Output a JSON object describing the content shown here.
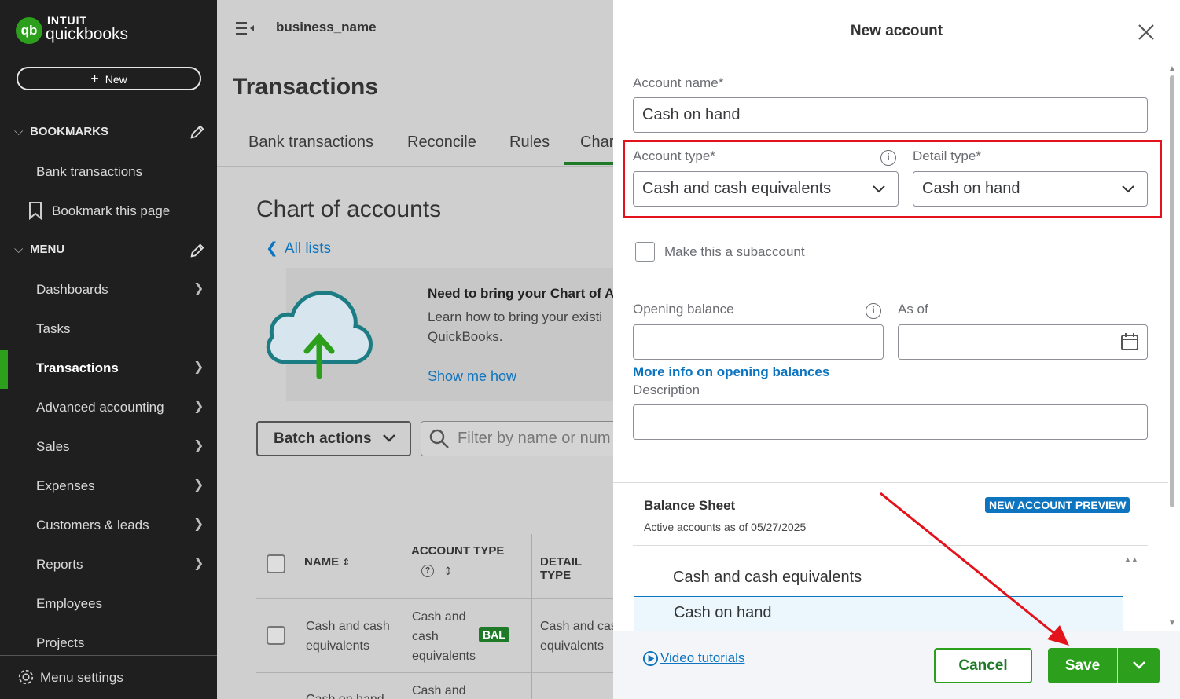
{
  "sidebar": {
    "brand_top": "INTUIT",
    "brand_bottom": "quickbooks",
    "new_label": "New",
    "bookmarks_heading": "BOOKMARKS",
    "bookmarks": [
      "Bank transactions",
      "Bookmark this page"
    ],
    "menu_heading": "MENU",
    "menu_items": [
      "Dashboards",
      "Tasks",
      "Transactions",
      "Advanced accounting",
      "Sales",
      "Expenses",
      "Customers & leads",
      "Reports",
      "Employees",
      "Projects"
    ],
    "menu_settings": "Menu settings",
    "accent_color": "#2ca01c"
  },
  "header": {
    "business_name": "business_name"
  },
  "main": {
    "page_title": "Transactions",
    "tabs": [
      "Bank transactions",
      "Reconcile",
      "Rules",
      "Char"
    ],
    "section_title": "Chart of accounts",
    "back_link": "All lists",
    "banner_title": "Need to bring your Chart of A",
    "banner_text_1": "Learn how to bring your existi",
    "banner_text_2": "QuickBooks.",
    "banner_link": "Show me how",
    "batch_actions": "Batch actions",
    "filter_placeholder": "Filter by name or num",
    "table_headers": {
      "name": "NAME",
      "account_type": "ACCOUNT TYPE",
      "detail_type": "DETAIL TYPE"
    },
    "rows": [
      {
        "name_1": "Cash and cash",
        "name_2": "equivalents",
        "type_1": "Cash and",
        "type_2": "cash",
        "type_3": "equivalents",
        "badge": "BAL",
        "detail_1": "Cash and cas",
        "detail_2": "equivalents"
      },
      {
        "name_1": "Cash on hand",
        "type_1": "Cash and"
      }
    ]
  },
  "drawer": {
    "title": "New account",
    "account_name_label": "Account name*",
    "account_name_value": "Cash on hand",
    "account_type_label": "Account type*",
    "account_type_value": "Cash and cash equivalents",
    "detail_type_label": "Detail type*",
    "detail_type_value": "Cash on hand",
    "subaccount_label": "Make this a subaccount",
    "opening_balance_label": "Opening balance",
    "opening_balance_value": "",
    "as_of_label": "As of",
    "as_of_value": "",
    "more_info_link": "More info on opening balances",
    "description_label": "Description",
    "description_value": "",
    "preview_title": "Balance Sheet",
    "preview_badge": "NEW ACCOUNT PREVIEW",
    "preview_subtitle": "Active accounts as of 05/27/2025",
    "preview_items": [
      "Cash and cash equivalents",
      "Cash on hand"
    ],
    "video_link": "Video tutorials",
    "cancel_label": "Cancel",
    "save_label": "Save",
    "highlight_color": "#e3121b"
  }
}
